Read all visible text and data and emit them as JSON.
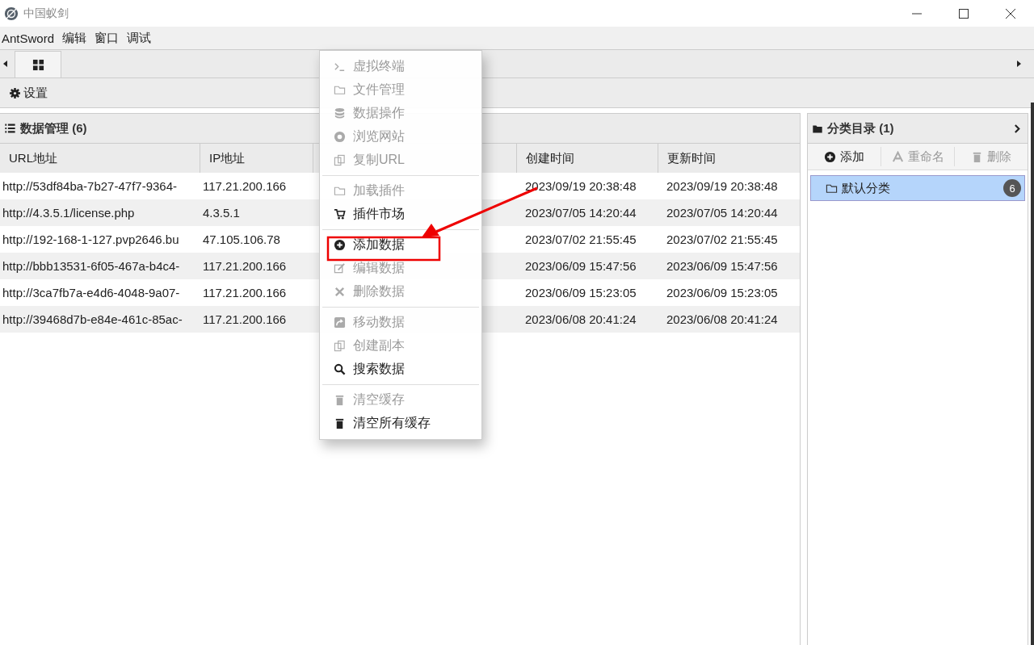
{
  "window": {
    "title": "中国蚁剑"
  },
  "menubar": [
    "AntSword",
    "编辑",
    "窗口",
    "调试"
  ],
  "toolbar": {
    "settings": "设置"
  },
  "data_panel": {
    "title": "数据管理 (6)",
    "columns": [
      "URL地址",
      "IP地址",
      "创建时间",
      "更新时间"
    ],
    "rows": [
      {
        "url": "http://53df84ba-7b27-47f7-9364-",
        "ip": "117.21.200.166",
        "created": "2023/09/19 20:38:48",
        "updated": "2023/09/19 20:38:48"
      },
      {
        "url": "http://4.3.5.1/license.php",
        "ip": "4.3.5.1",
        "created": "2023/07/05 14:20:44",
        "updated": "2023/07/05 14:20:44"
      },
      {
        "url": "http://192-168-1-127.pvp2646.bu",
        "ip": "47.105.106.78",
        "created": "2023/07/02 21:55:45",
        "updated": "2023/07/02 21:55:45"
      },
      {
        "url": "http://bbb13531-6f05-467a-b4c4-",
        "ip": "117.21.200.166",
        "created": "2023/06/09 15:47:56",
        "updated": "2023/06/09 15:47:56"
      },
      {
        "url": "http://3ca7fb7a-e4d6-4048-9a07-",
        "ip": "117.21.200.166",
        "created": "2023/06/09 15:23:05",
        "updated": "2023/06/09 15:23:05"
      },
      {
        "url": "http://39468d7b-e84e-461c-85ac-",
        "ip": "117.21.200.166",
        "created": "2023/06/08 20:41:24",
        "updated": "2023/06/08 20:41:24"
      }
    ]
  },
  "category_panel": {
    "title": "分类目录 (1)",
    "actions": [
      {
        "label": "添加",
        "disabled": false
      },
      {
        "label": "重命名",
        "disabled": true
      },
      {
        "label": "删除",
        "disabled": true
      }
    ],
    "items": [
      {
        "label": "默认分类",
        "count": "6",
        "selected": true
      }
    ]
  },
  "context_menu": [
    {
      "kind": "item",
      "label": "虚拟终端",
      "disabled": true
    },
    {
      "kind": "item",
      "label": "文件管理",
      "disabled": true
    },
    {
      "kind": "item",
      "label": "数据操作",
      "disabled": true
    },
    {
      "kind": "item",
      "label": "浏览网站",
      "disabled": true
    },
    {
      "kind": "item",
      "label": "复制URL",
      "disabled": true
    },
    {
      "kind": "separator"
    },
    {
      "kind": "item",
      "label": "加载插件",
      "disabled": true
    },
    {
      "kind": "item",
      "label": "插件市场",
      "disabled": false
    },
    {
      "kind": "separator"
    },
    {
      "kind": "item",
      "label": "添加数据",
      "disabled": false
    },
    {
      "kind": "item",
      "label": "编辑数据",
      "disabled": true
    },
    {
      "kind": "item",
      "label": "删除数据",
      "disabled": true
    },
    {
      "kind": "separator"
    },
    {
      "kind": "item",
      "label": "移动数据",
      "disabled": true
    },
    {
      "kind": "item",
      "label": "创建副本",
      "disabled": true
    },
    {
      "kind": "item",
      "label": "搜索数据",
      "disabled": false
    },
    {
      "kind": "separator"
    },
    {
      "kind": "item",
      "label": "清空缓存",
      "disabled": true
    },
    {
      "kind": "item",
      "label": "清空所有缓存",
      "disabled": false
    }
  ]
}
